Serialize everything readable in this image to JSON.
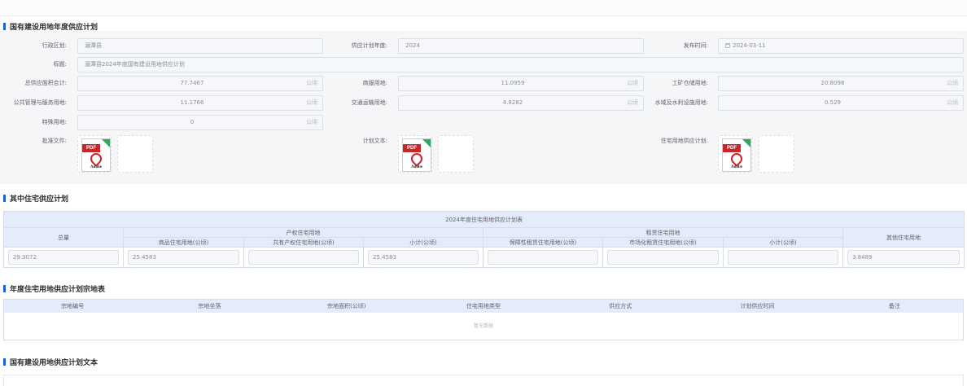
{
  "section1": {
    "title": "国有建设用地年度供应计划",
    "fields": {
      "region_label": "行政区划:",
      "region_value": "湄潭县",
      "year_label": "供应计划年度:",
      "year_value": "2024",
      "publish_label": "发布时间:",
      "publish_value": "2024-03-11",
      "title_label": "标题:",
      "title_value": "湄潭县2024年度国有建设用地供应计划",
      "total_label": "总供应面积合计:",
      "total_value": "77.7467",
      "commercial_label": "商服用地:",
      "commercial_value": "11.0959",
      "industrial_label": "工矿仓储用地:",
      "industrial_value": "20.8098",
      "public_label": "公共管理与服务用地:",
      "public_value": "11.1766",
      "transport_label": "交通运输用地:",
      "transport_value": "4.8282",
      "water_label": "水域及水利设施用地:",
      "water_value": "0.529",
      "special_label": "特殊用地:",
      "special_value": "0",
      "unit": "公顷"
    },
    "files": {
      "approval_label": "批准文件:",
      "plan_text_label": "计划文本:",
      "residential_plan_label": "住宅用地供应计划:",
      "pdf_tag": "PDF",
      "pdf_brand": "Adobe"
    }
  },
  "section2": {
    "title": "其中住宅供应计划",
    "table_title": "2024年度住宅用地供应计划表",
    "col_total": "总量",
    "group_property": "产权住宅用地",
    "group_rental": "租赁住宅用地",
    "col_other": "其他住宅用地",
    "sub_commodity": "商品住宅用地(公顷)",
    "sub_shared": "共有产权住宅用地(公顷)",
    "sub_subtotal1": "小计(公顷)",
    "sub_affordable": "保障性租赁住宅用地(公顷)",
    "sub_market": "市场化租赁住宅用地(公顷)",
    "sub_subtotal2": "小计(公顷)",
    "values": {
      "total": "29.3072",
      "commodity": "25.4583",
      "shared": "",
      "subtotal1": "25.4583",
      "affordable": "",
      "market": "",
      "subtotal2": "",
      "other": "3.8489"
    }
  },
  "section3": {
    "title": "年度住宅用地供应计划宗地表",
    "columns": [
      "宗地编号",
      "宗地坐落",
      "宗地面积(公顷)",
      "住宅用地类型",
      "供应方式",
      "计划供应时间",
      "备注"
    ],
    "empty_text": "暂无数据"
  },
  "section4": {
    "title": "国有建设用地供应计划文本"
  }
}
